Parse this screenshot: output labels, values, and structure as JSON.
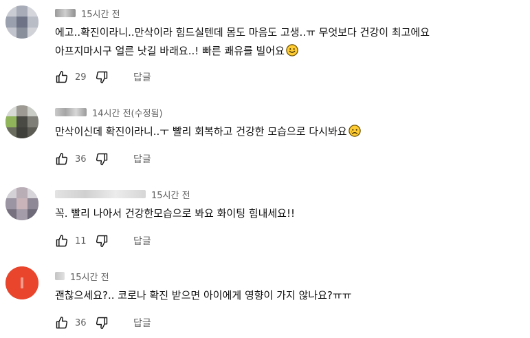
{
  "comments": [
    {
      "timestamp": "15시간 전",
      "text_lines": [
        "에고..확진이라니..만삭이라 힘드실텐데 몸도 마음도 고생..ㅠ 무엇보다 건강이 최고에요",
        "아프지마시구 얼른 낫길 바래요..! 빠른 쾌유를 빌어요"
      ],
      "emoji": "smiling-face-emoji",
      "likes": "29",
      "reply_label": "답글"
    },
    {
      "timestamp": "14시간 전(수정됨)",
      "text_lines": [
        "만삭이신데 확진이라니..ㅜ 빨리 회복하고 건강한 모습으로 다시봐요"
      ],
      "emoji": "sad-face-emoji",
      "likes": "36",
      "reply_label": "답글"
    },
    {
      "timestamp": "15시간 전",
      "text_lines": [
        "꼭. 빨리 나아서 건강한모습으로 봐요 화이팅 힘내세요!!"
      ],
      "emoji": "",
      "likes": "11",
      "reply_label": "답글"
    },
    {
      "timestamp": "15시간 전",
      "text_lines": [
        "괜찮으세요?.. 코로나 확진 받으면 아이에게 영향이 가지 않나요?ㅠㅠ"
      ],
      "emoji": "",
      "likes": "36",
      "reply_label": "답글"
    }
  ],
  "colors": {
    "text": "#0f0f0f",
    "secondary": "#606060",
    "avatar_4": "#e8452c"
  },
  "icons": {
    "like": "thumbs-up-icon",
    "dislike": "thumbs-down-icon"
  }
}
